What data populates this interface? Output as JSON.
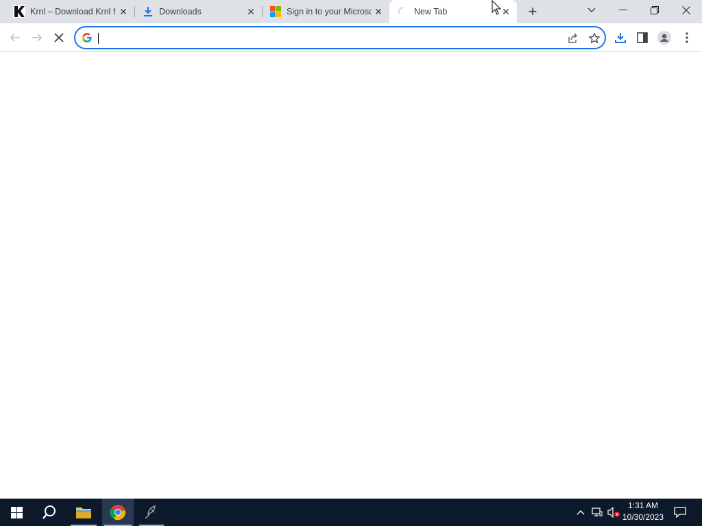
{
  "browser": {
    "tabs": [
      {
        "title": "Krnl – Download Krnl fo",
        "favicon": "krnl-logo-icon",
        "active": false
      },
      {
        "title": "Downloads",
        "favicon": "download-arrow-icon",
        "active": false
      },
      {
        "title": "Sign in to your Microsoft",
        "favicon": "microsoft-logo-icon",
        "active": false
      },
      {
        "title": "New Tab",
        "favicon": "loading-spinner-icon",
        "active": true
      }
    ],
    "new_tab_symbol": "+",
    "close_symbol": "✕",
    "omnibox": {
      "value": "",
      "placeholder": ""
    },
    "colors": {
      "tab_strip": "#dee1e6",
      "accent": "#1a73e8",
      "download_icon": "#1a73e8"
    }
  },
  "taskbar": {
    "apps": [
      "start-icon",
      "search-icon",
      "file-explorer-icon",
      "chrome-icon",
      "krnl-app-icon"
    ],
    "clock": {
      "time": "1:31 AM",
      "date": "10/30/2023"
    },
    "colors": {
      "background": "#0c1a2b",
      "running_indicator": "#76b9ed"
    }
  }
}
